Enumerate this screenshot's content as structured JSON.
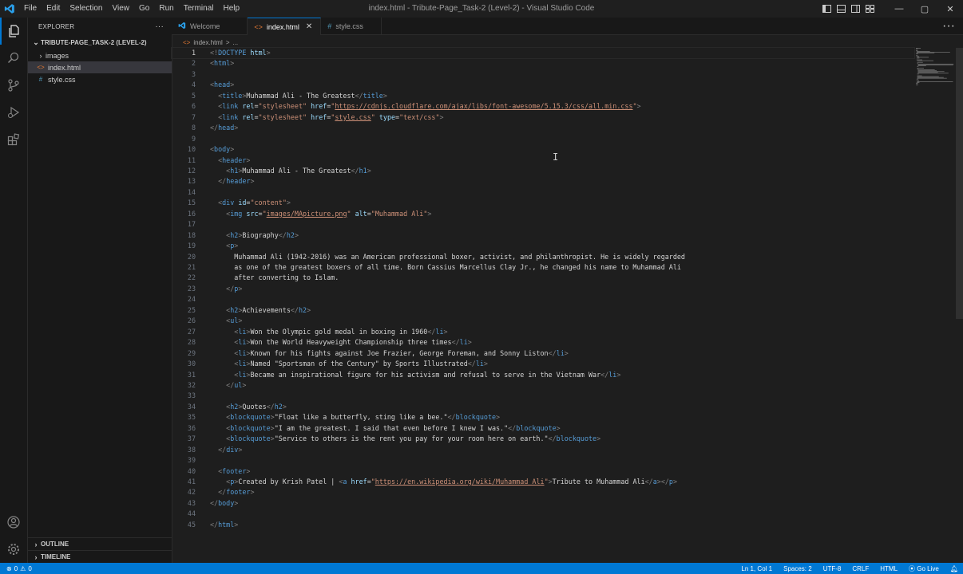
{
  "titlebar": {
    "menus": [
      "File",
      "Edit",
      "Selection",
      "View",
      "Go",
      "Run",
      "Terminal",
      "Help"
    ],
    "window_title": "index.html - Tribute-Page_Task-2 (Level-2) - Visual Studio Code",
    "minimize": "—",
    "maximize": "▢",
    "close": "✕"
  },
  "sidebar": {
    "header": "EXPLORER",
    "more": "···",
    "folder": "TRIBUTE-PAGE_TASK-2 (LEVEL-2)",
    "items": [
      {
        "label": "images",
        "type": "folder"
      },
      {
        "label": "index.html",
        "type": "html"
      },
      {
        "label": "style.css",
        "type": "css"
      }
    ],
    "outline": "OUTLINE",
    "timeline": "TIMELINE"
  },
  "tabs": [
    {
      "label": "Welcome",
      "icon": "vscode-icon"
    },
    {
      "label": "index.html",
      "icon": "html-file-icon",
      "active": true
    },
    {
      "label": "style.css",
      "icon": "css-file-icon"
    }
  ],
  "breadcrumb": {
    "file": "index.html",
    "sep": ">",
    "rest": "..."
  },
  "editor": {
    "current_line": 1,
    "lines": [
      "<!DOCTYPE html>",
      "<html>",
      "",
      "<head>",
      "  <title>Muhammad Ali - The Greatest</title>",
      "  <link rel=\"stylesheet\" href=\"https://cdnjs.cloudflare.com/ajax/libs/font-awesome/5.15.3/css/all.min.css\">",
      "  <link rel=\"stylesheet\" href=\"style.css\" type=\"text/css\">",
      "</head>",
      "",
      "<body>",
      "  <header>",
      "    <h1>Muhammad Ali - The Greatest</h1>",
      "  </header>",
      "",
      "  <div id=\"content\">",
      "    <img src=\"images/MApicture.png\" alt=\"Muhammad Ali\">",
      "",
      "    <h2>Biography</h2>",
      "    <p>",
      "      Muhammad Ali (1942-2016) was an American professional boxer, activist, and philanthropist. He is widely regarded",
      "      as one of the greatest boxers of all time. Born Cassius Marcellus Clay Jr., he changed his name to Muhammad Ali",
      "      after converting to Islam.",
      "    </p>",
      "",
      "    <h2>Achievements</h2>",
      "    <ul>",
      "      <li>Won the Olympic gold medal in boxing in 1960</li>",
      "      <li>Won the World Heavyweight Championship three times</li>",
      "      <li>Known for his fights against Joe Frazier, George Foreman, and Sonny Liston</li>",
      "      <li>Named \"Sportsman of the Century\" by Sports Illustrated</li>",
      "      <li>Became an inspirational figure for his activism and refusal to serve in the Vietnam War</li>",
      "    </ul>",
      "",
      "    <h2>Quotes</h2>",
      "    <blockquote>\"Float like a butterfly, sting like a bee.\"</blockquote>",
      "    <blockquote>\"I am the greatest. I said that even before I knew I was.\"</blockquote>",
      "    <blockquote>\"Service to others is the rent you pay for your room here on earth.\"</blockquote>",
      "  </div>",
      "",
      "  <footer>",
      "    <p>Created by Krish Patel | <a href=\"https://en.wikipedia.org/wiki/Muhammad_Ali\">Tribute to Muhammad Ali</a></p>",
      "  </footer>",
      "</body>",
      "",
      "</html>"
    ]
  },
  "statusbar": {
    "errors": "0",
    "warnings": "0",
    "position": "Ln 1, Col 1",
    "spaces": "Spaces: 2",
    "encoding": "UTF-8",
    "eol": "CRLF",
    "language": "HTML",
    "golive": "Go Live"
  },
  "colors": {
    "accent": "#0078d4",
    "tag": "#569cd6",
    "attr": "#9cdcfe",
    "string": "#ce9178",
    "punct": "#808080"
  }
}
